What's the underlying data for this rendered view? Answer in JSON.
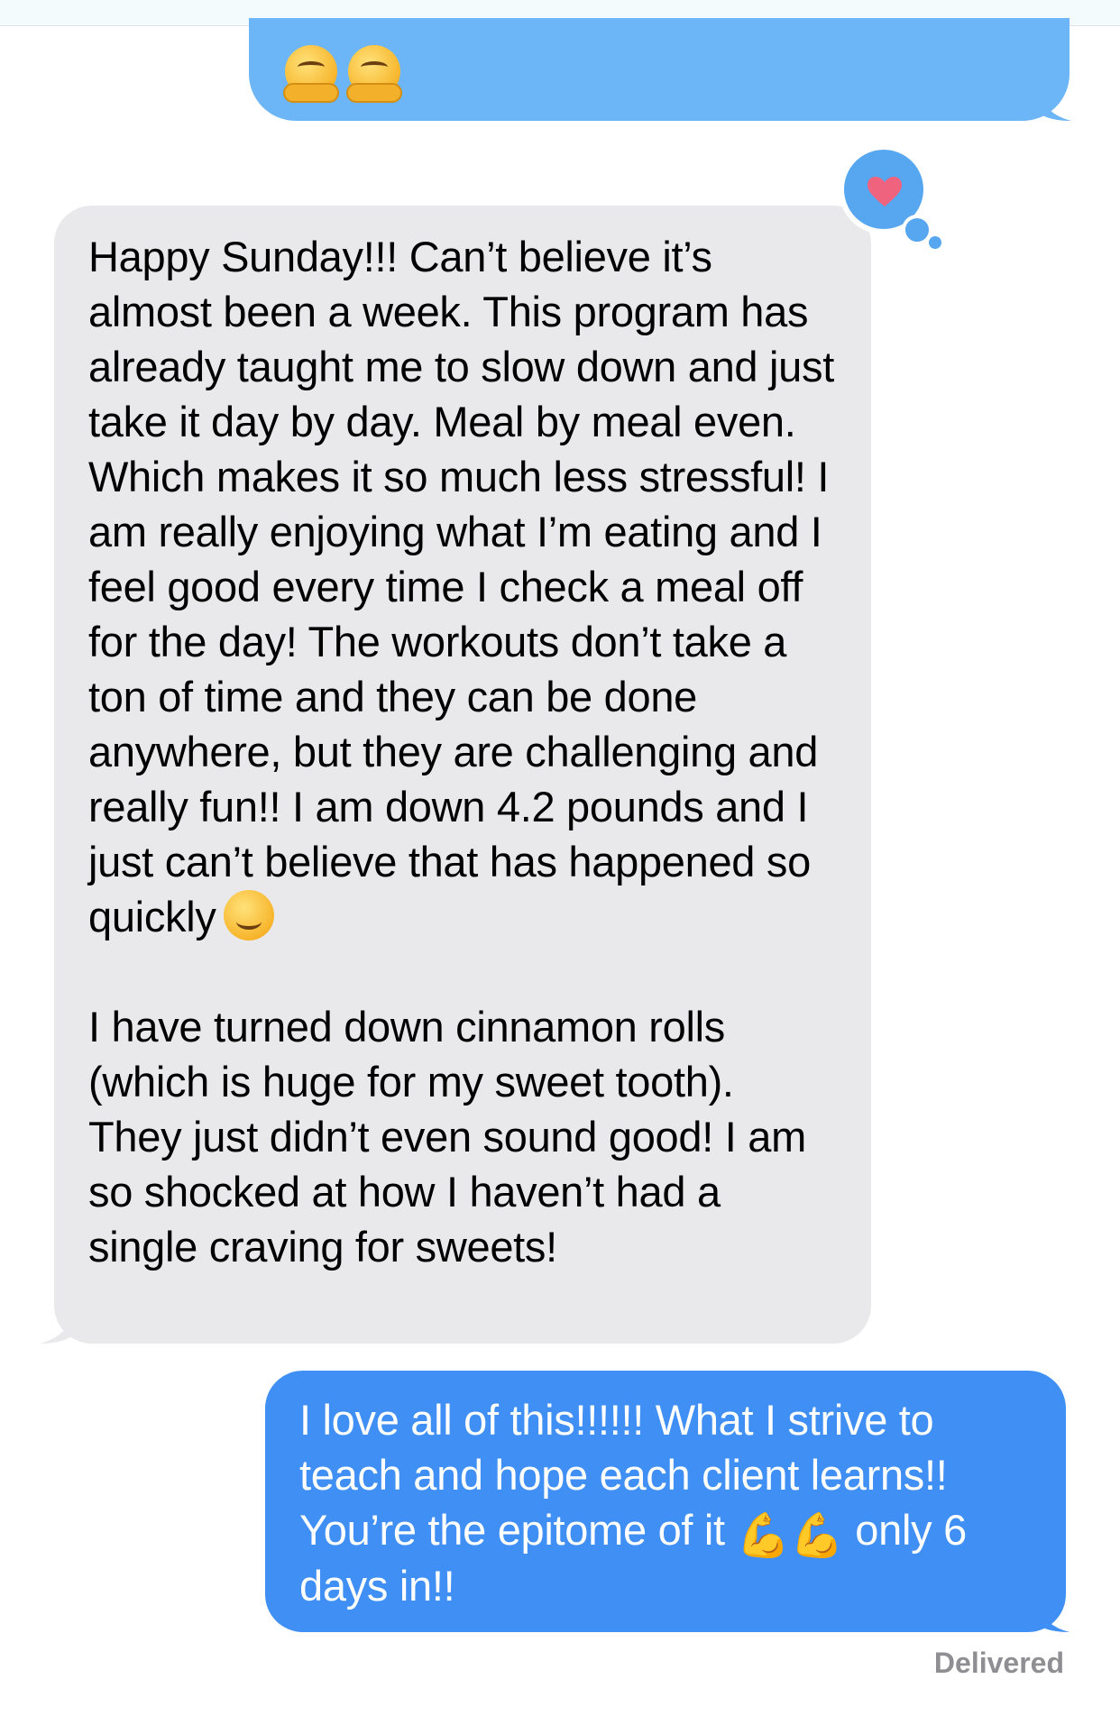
{
  "thread": {
    "top_message": {
      "sender": "me",
      "emoji": [
        "hugging-face",
        "hugging-face"
      ]
    },
    "received_message": {
      "tapback": "heart",
      "paragraph_1": "Happy Sunday!!! Can’t believe it’s almost been a week. This program has already taught me to slow down and just take it day by day. Meal by meal even. Which makes it so much less stressful! I am really enjoying what I’m eating and I feel good every time I check a meal off for the day! The workouts don’t take a ton of time and they can be done anywhere, but they are challenging and really fun!! I am down 4.2 pounds and I just can’t believe that has happened so quickly",
      "paragraph_1_emoji": "smiling-face",
      "paragraph_2": "I have turned down cinnamon rolls (which is huge for my sweet tooth). They just didn’t even sound good! I am so shocked at how I haven’t had a single craving for sweets!"
    },
    "sent_message": {
      "text_before": "I love all of this!!!!!! What I strive to teach and hope each client learns!! You’re the epitome of it",
      "emoji": [
        "flexed-biceps",
        "flexed-biceps"
      ],
      "text_after": "only 6 days in!!"
    },
    "status": "Delivered"
  },
  "colors": {
    "sent_bubble": "#3f8ff4",
    "sent_bubble_light": "#6cb5f6",
    "received_bubble": "#e9e9eb",
    "tapback_bg": "#56a7ef",
    "heart": "#f0637f",
    "status_text": "#8e8e93"
  }
}
